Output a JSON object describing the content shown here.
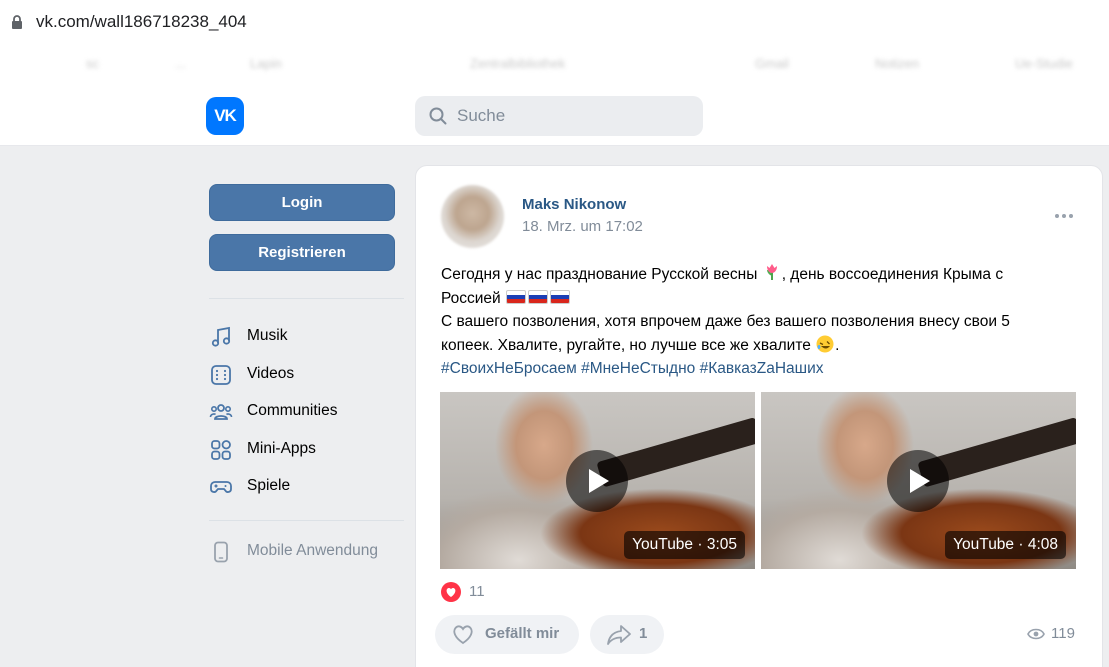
{
  "browser": {
    "url": "vk.com/wall186718238_404",
    "bookmarks": [
      "sc",
      "...",
      "Lapin",
      "Zentralbibliothek",
      "Gmail",
      "Notizen",
      "Ue-Studie"
    ]
  },
  "header": {
    "logo_text": "VK",
    "search_placeholder": "Suche"
  },
  "sidebar": {
    "login_label": "Login",
    "register_label": "Registrieren",
    "items": [
      {
        "label": "Musik",
        "icon": "music-icon"
      },
      {
        "label": "Videos",
        "icon": "video-icon"
      },
      {
        "label": "Communities",
        "icon": "communities-icon"
      },
      {
        "label": "Mini-Apps",
        "icon": "mini-apps-icon"
      },
      {
        "label": "Spiele",
        "icon": "gamepad-icon"
      }
    ],
    "mobile_label": "Mobile Anwendung"
  },
  "post": {
    "author": "Maks Nikonow",
    "time": "18. Mrz. um 17:02",
    "text_line1_a": "Сегодня у нас празднование Русской весны",
    "text_line1_b": ", день воссоединения Крыма с",
    "text_line2": "Россией",
    "text_line3": "С вашего позволения, хотя впрочем даже без вашего позволения внесу свои 5",
    "text_line4": "копеек. Хвалите, ругайте, но лучше все же хвалите",
    "text_line4_end": ".",
    "hashtags": "#СвоихНеБросаем #МнеНеСтыдно #КавказZaНаших",
    "videos": [
      {
        "duration": "YouTube · 3:05"
      },
      {
        "duration": "YouTube · 4:08"
      }
    ],
    "reactions_count": "11",
    "like_label": "Gefällt mir",
    "share_count": "1",
    "views": "119"
  },
  "colors": {
    "vk_blue": "#0077ff",
    "button_blue": "#4a76a8",
    "link_blue": "#2a5885",
    "muted": "#818c99",
    "like_red": "#ff3347"
  }
}
